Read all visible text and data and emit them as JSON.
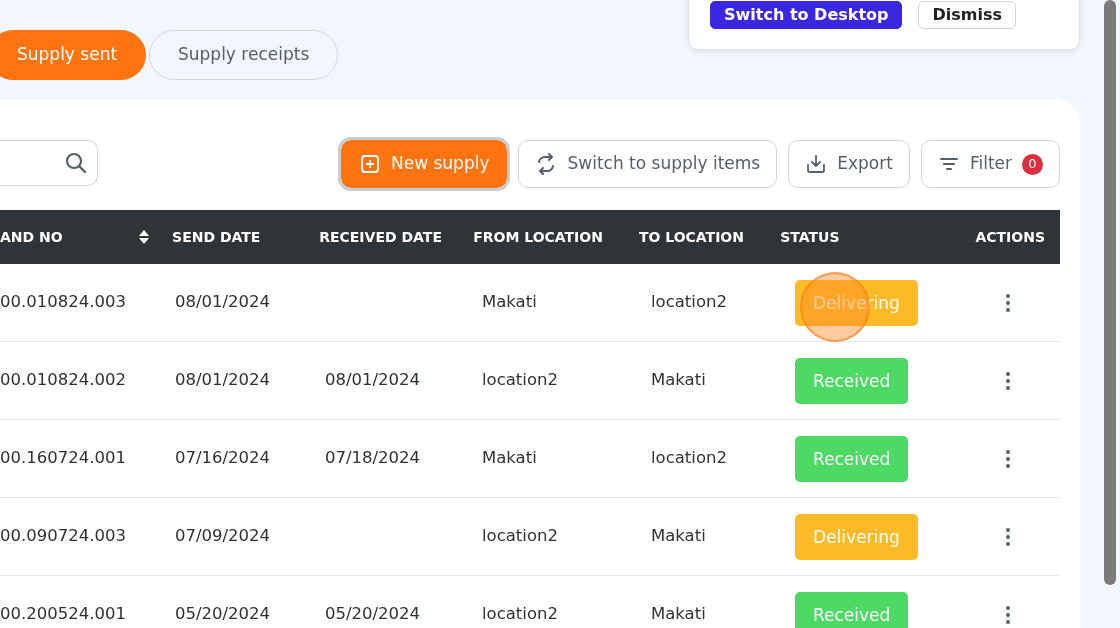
{
  "tabs": [
    {
      "label": "Supply sent",
      "selected": true
    },
    {
      "label": "Supply receipts",
      "selected": false
    }
  ],
  "popup": {
    "buttons": [
      {
        "label": "Switch to Desktop",
        "kind": "primary"
      },
      {
        "label": "Dismiss",
        "kind": "secondary"
      }
    ]
  },
  "toolbar": {
    "buttons": [
      {
        "label": "New supply",
        "kind": "primary"
      },
      {
        "label": "Switch to supply items",
        "kind": "outline"
      },
      {
        "label": "Export",
        "kind": "outline"
      },
      {
        "label": "Filter",
        "kind": "outline",
        "badge": "0"
      }
    ]
  },
  "table": {
    "columns": [
      {
        "label": "AND NO",
        "sortable": true
      },
      {
        "label": "SEND DATE",
        "sortable": false
      },
      {
        "label": "RECEIVED DATE",
        "sortable": false
      },
      {
        "label": "FROM LOCATION",
        "sortable": false
      },
      {
        "label": "TO LOCATION",
        "sortable": false
      },
      {
        "label": "STATUS",
        "sortable": false
      },
      {
        "label": "ACTIONS",
        "sortable": false
      }
    ],
    "rows": [
      {
        "cells": [
          "00.010824.003",
          "08/01/2024",
          "",
          "Makati",
          "location2"
        ],
        "status": {
          "label": "Delivering",
          "kind": "delivering"
        },
        "click_marker": true
      },
      {
        "cells": [
          "00.010824.002",
          "08/01/2024",
          "08/01/2024",
          "location2",
          "Makati"
        ],
        "status": {
          "label": "Received",
          "kind": "received"
        },
        "click_marker": false
      },
      {
        "cells": [
          "00.160724.001",
          "07/16/2024",
          "07/18/2024",
          "Makati",
          "location2"
        ],
        "status": {
          "label": "Received",
          "kind": "received"
        },
        "click_marker": false
      },
      {
        "cells": [
          "00.090724.003",
          "07/09/2024",
          "",
          "location2",
          "Makati"
        ],
        "status": {
          "label": "Delivering",
          "kind": "delivering"
        },
        "click_marker": false
      },
      {
        "cells": [
          "00.200524.001",
          "05/20/2024",
          "05/20/2024",
          "location2",
          "Makati"
        ],
        "status": {
          "label": "Received",
          "kind": "received"
        },
        "click_marker": false
      }
    ]
  }
}
